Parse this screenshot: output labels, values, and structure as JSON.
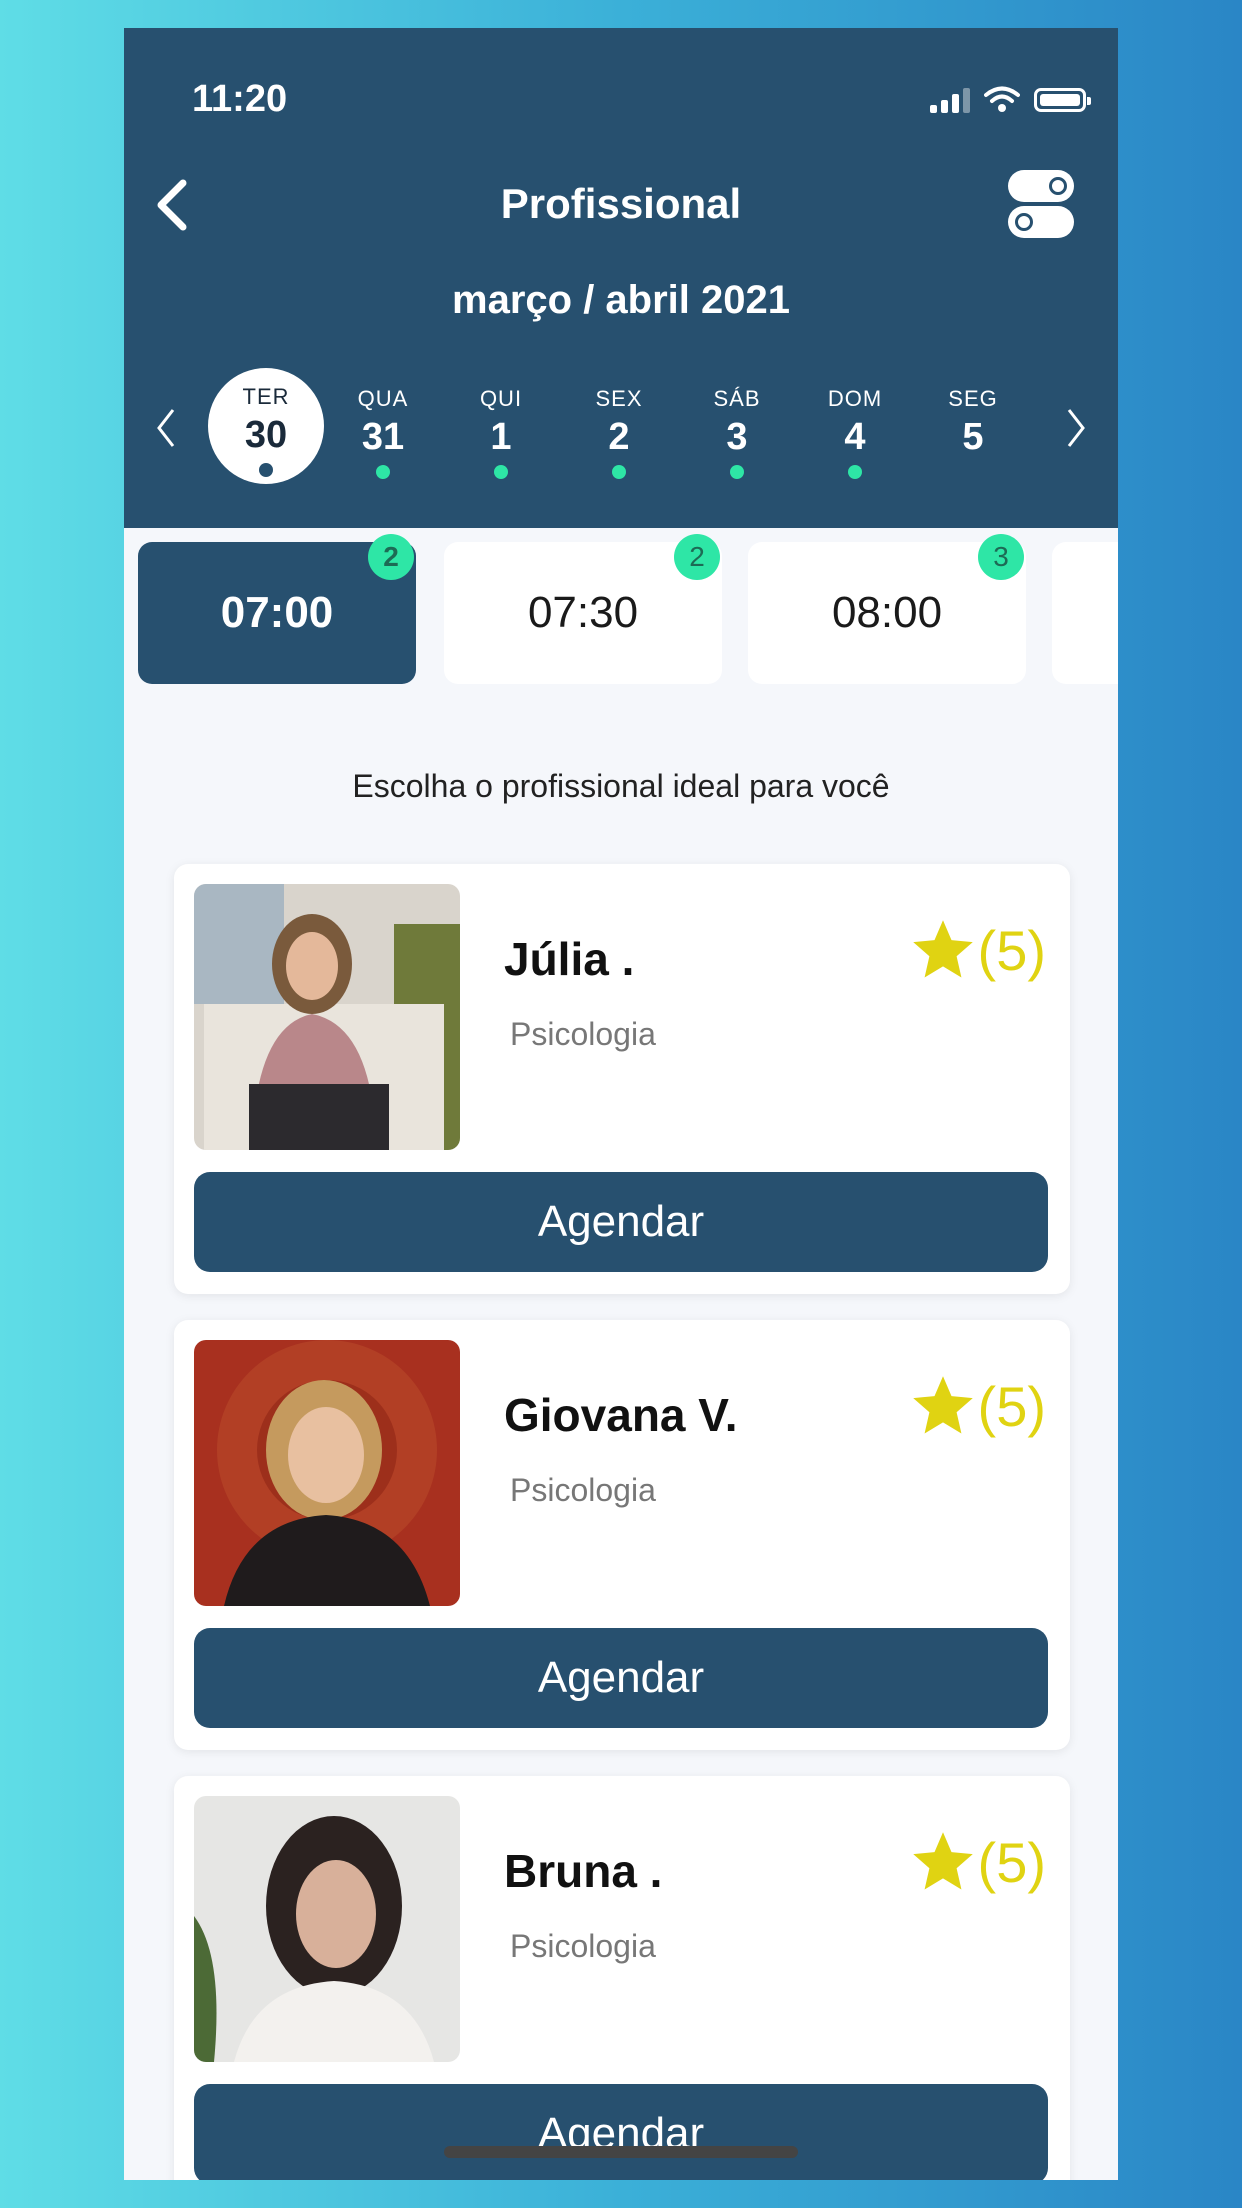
{
  "status_bar": {
    "time": "11:20"
  },
  "header": {
    "title": "Profissional",
    "month_label": "março / abril 2021"
  },
  "days": [
    {
      "weekday": "TER",
      "day": "30",
      "active": true
    },
    {
      "weekday": "QUA",
      "day": "31"
    },
    {
      "weekday": "QUI",
      "day": "1"
    },
    {
      "weekday": "SEX",
      "day": "2"
    },
    {
      "weekday": "SÁB",
      "day": "3"
    },
    {
      "weekday": "DOM",
      "day": "4"
    },
    {
      "weekday": "SEG",
      "day": "5"
    }
  ],
  "time_slots": [
    {
      "time": "07:00",
      "count": "2",
      "selected": true
    },
    {
      "time": "07:30",
      "count": "2"
    },
    {
      "time": "08:00",
      "count": "3"
    }
  ],
  "subtitle": "Escolha o profissional ideal para você",
  "professionals": [
    {
      "name": "Júlia .",
      "specialty": "Psicologia",
      "rating": "(5)",
      "button": "Agendar"
    },
    {
      "name": "Giovana V.",
      "specialty": "Psicologia",
      "rating": "(5)",
      "button": "Agendar"
    },
    {
      "name": "Bruna .",
      "specialty": "Psicologia",
      "rating": "(5)",
      "button": "Agendar"
    }
  ],
  "colors": {
    "primary": "#27506f",
    "accent": "#2ee6a6",
    "star": "#e0d312"
  }
}
